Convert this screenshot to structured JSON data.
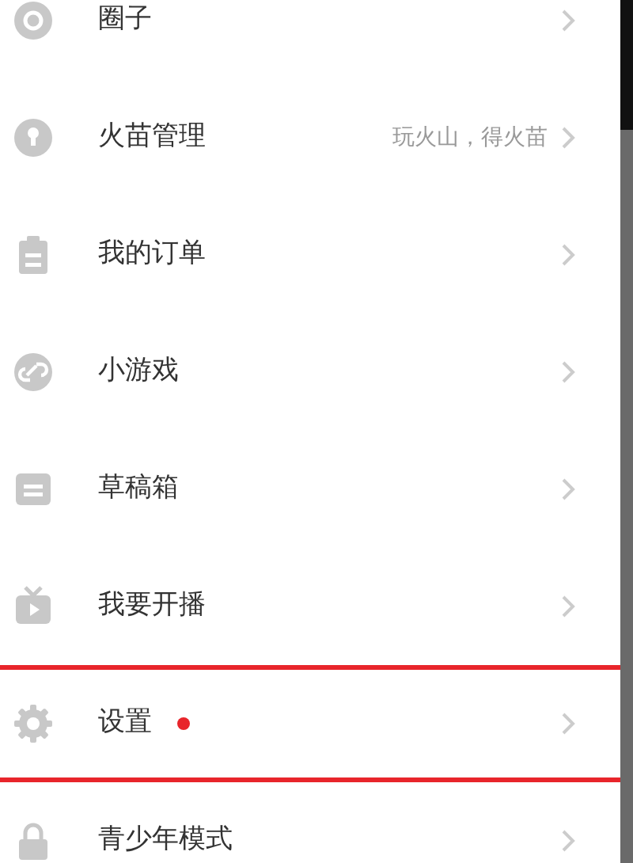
{
  "menu": {
    "items": [
      {
        "label": "圈子",
        "dot": false,
        "highlighted": false
      },
      {
        "label": "火苗管理",
        "detail": "玩火山，得火苗",
        "dot": false,
        "highlighted": false
      },
      {
        "label": "我的订单",
        "dot": false,
        "highlighted": false
      },
      {
        "label": "小游戏",
        "dot": false,
        "highlighted": false
      },
      {
        "label": "草稿箱",
        "dot": false,
        "highlighted": false
      },
      {
        "label": "我要开播",
        "dot": false,
        "highlighted": false
      },
      {
        "label": "设置",
        "dot": true,
        "highlighted": true
      },
      {
        "label": "青少年模式",
        "dot": false,
        "highlighted": false
      }
    ]
  }
}
